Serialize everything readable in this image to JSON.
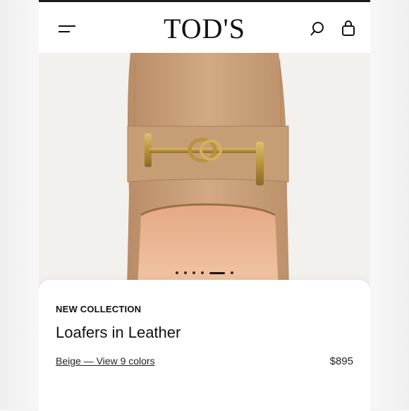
{
  "header": {
    "brand": "TOD'S",
    "icons": [
      "menu-icon",
      "search-icon",
      "shopping-bag-icon"
    ]
  },
  "carousel": {
    "dot_count": 6,
    "active_index": 4
  },
  "product": {
    "eyebrow": "NEW COLLECTION",
    "name": "Loafers in Leather",
    "color_link": "Beige — View 9 colors",
    "price": "$895"
  },
  "colors": {
    "leather": "#c9a07a",
    "hardware": "#b8923e",
    "lining": "#eab795"
  }
}
